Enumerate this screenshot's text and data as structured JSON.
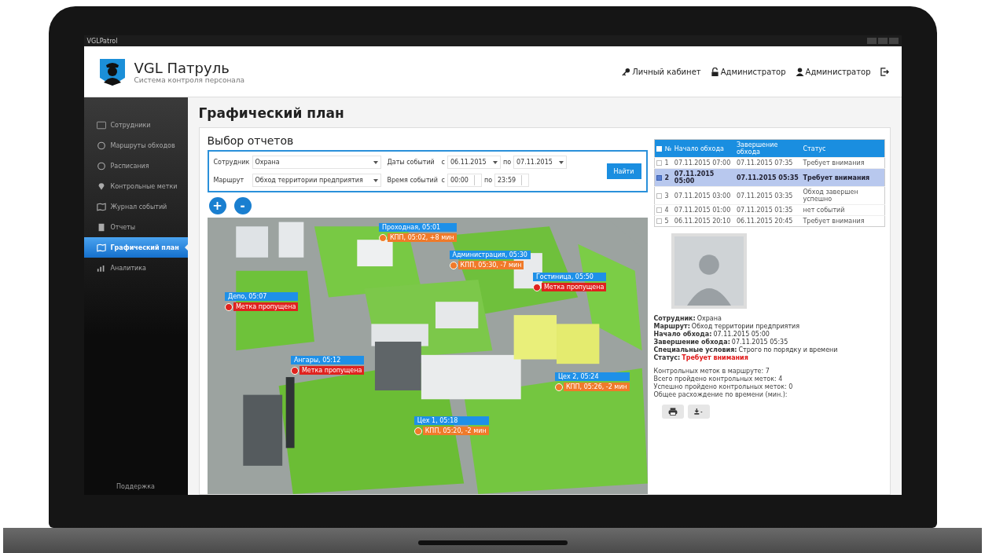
{
  "window": {
    "title": "VGLPatrol"
  },
  "header": {
    "app_name": "VGL Патруль",
    "subtitle": "Система контроля персонала",
    "links": [
      "Личный кабинет",
      "Администратор",
      "Администратор"
    ]
  },
  "sidebar": {
    "items": [
      {
        "label": "Сотрудники",
        "selected": false
      },
      {
        "label": "Маршруты обходов",
        "selected": false
      },
      {
        "label": "Расписания",
        "selected": false
      },
      {
        "label": "Контрольные метки",
        "selected": false
      },
      {
        "label": "Журнал событий",
        "selected": false
      },
      {
        "label": "Отчеты",
        "selected": false
      },
      {
        "label": "Графический план",
        "selected": true
      },
      {
        "label": "Аналитика",
        "selected": false
      }
    ],
    "footer": "Поддержка"
  },
  "page_title": "Графический план",
  "report_form": {
    "title": "Выбор отчетов",
    "employee": {
      "label": "Сотрудник",
      "value": "Охрана"
    },
    "route": {
      "label": "Маршрут",
      "value": "Обход территории предприятия"
    },
    "dates": {
      "label": "Даты событий",
      "from_label": "с",
      "from": "06.11.2015",
      "to_label": "по",
      "to": "07.11.2015"
    },
    "times": {
      "label": "Время событий",
      "from_label": "с",
      "from": "00:00",
      "to_label": "по",
      "to": "23:59"
    },
    "find_button": "Найти"
  },
  "zoom_buttons": [
    "+",
    "-"
  ],
  "map": {
    "markers": [
      {
        "label": "Проходная, 05:01",
        "note": "КПП, 05:02, +8 мин",
        "kind": "late"
      },
      {
        "label": "Администрация, 05:30",
        "note": "КПП, 05:30, -7 мин",
        "kind": "late"
      },
      {
        "label": "Гостиница, 05:50",
        "note": "Метка пропущена",
        "kind": "missed"
      },
      {
        "label": "Депо, 05:07",
        "note": "Метка пропущена",
        "kind": "missed"
      },
      {
        "label": "Ангары, 05:12",
        "note": "Метка пропущена",
        "kind": "missed"
      },
      {
        "label": "Цех 2, 05:24",
        "note": "КПП, 05:26, -2 мин",
        "kind": "late"
      },
      {
        "label": "Цех 1, 05:18",
        "note": "КПП, 05:20, -2 мин",
        "kind": "late"
      }
    ]
  },
  "table": {
    "all_selected": false,
    "columns": [
      "№",
      "Начало обхода",
      "Завершение обхода",
      "Статус"
    ],
    "rows": [
      {
        "cells": [
          "1",
          "07.11.2015 07:00",
          "07.11.2015 07:35",
          "Требует внимания"
        ],
        "selected": false
      },
      {
        "cells": [
          "2",
          "07.11.2015 05:00",
          "07.11.2015 05:35",
          "Требует внимания"
        ],
        "selected": true
      },
      {
        "cells": [
          "3",
          "07.11.2015 03:00",
          "07.11.2015 03:35",
          "Обход завершен успешно"
        ],
        "selected": false
      },
      {
        "cells": [
          "4",
          "07.11.2015 01:00",
          "07.11.2015 01:35",
          "нет событий"
        ],
        "selected": false
      },
      {
        "cells": [
          "5",
          "06.11.2015 20:10",
          "06.11.2015 20:45",
          "Требует внимания"
        ],
        "selected": false
      }
    ]
  },
  "details": [
    {
      "label": "Сотрудник:",
      "value": "Охрана",
      "alert": false
    },
    {
      "label": "Маршрут:",
      "value": "Обход территории предприятия",
      "alert": false
    },
    {
      "label": "Начало обхода:",
      "value": "07.11.2015 05:00",
      "alert": false
    },
    {
      "label": "Завершение обхода:",
      "value": "07.11.2015 05:35",
      "alert": false
    },
    {
      "label": "Специальные условия:",
      "value": "Строго по порядку и времени",
      "alert": false
    },
    {
      "label": "Статус:",
      "value": "Требует внимания",
      "alert": true
    }
  ],
  "stats": [
    "Контрольных меток в маршруте: 7",
    "Всего пройдено контрольных меток: 4",
    "Успешно пройдено контрольных меток: 0",
    "Общее расхождение по времени (мин.):"
  ]
}
